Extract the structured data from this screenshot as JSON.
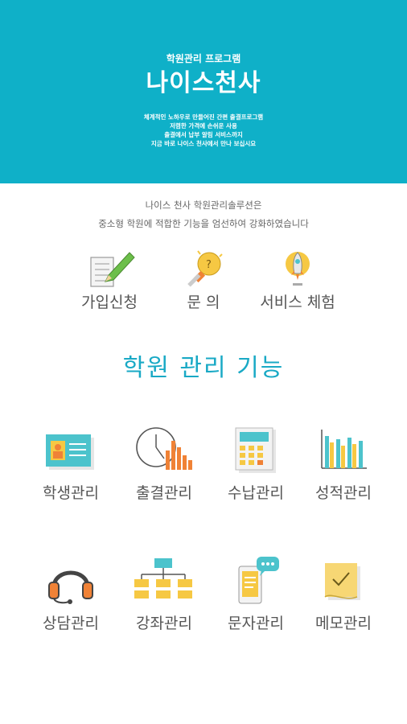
{
  "hero": {
    "subtitle": "학원관리 프로그램",
    "title": "나이스천사",
    "desc": [
      "체계적인 노하우로 만들어진 간편 출결프로그램",
      "저렴한 가격에 손쉬운 사용",
      "출결에서 납부 알림 서비스까지",
      "지금 바로 나이스 천사에서 만나 보십시요"
    ]
  },
  "intro": [
    "나이스 천사 학원관리솔루션은",
    "중소형 학원에 적합한 기능을 엄선하여 강화하였습니다"
  ],
  "quick": [
    {
      "label": "가입신청",
      "icon": "signup-form-pencil-icon"
    },
    {
      "label": "문 의",
      "icon": "inquiry-lightbulb-icon"
    },
    {
      "label": "서비스 체험",
      "icon": "service-rocket-icon"
    }
  ],
  "section_title": "학원 관리 기능",
  "features": [
    {
      "label": "학생관리",
      "icon": "student-id-card-icon"
    },
    {
      "label": "출결관리",
      "icon": "attendance-clock-icon"
    },
    {
      "label": "수납관리",
      "icon": "payment-calculator-icon"
    },
    {
      "label": "성적관리",
      "icon": "grades-bar-chart-icon"
    },
    {
      "label": "상담관리",
      "icon": "counseling-headset-icon"
    },
    {
      "label": "강좌관리",
      "icon": "course-hierarchy-icon"
    },
    {
      "label": "문자관리",
      "icon": "sms-phone-chat-icon"
    },
    {
      "label": "메모관리",
      "icon": "memo-note-icon"
    }
  ],
  "colors": {
    "hero_bg": "#0fb0c8",
    "accent": "#19a9c5",
    "icon_teal": "#4cc3cc",
    "icon_orange": "#f08236",
    "icon_yellow": "#f6c843"
  }
}
